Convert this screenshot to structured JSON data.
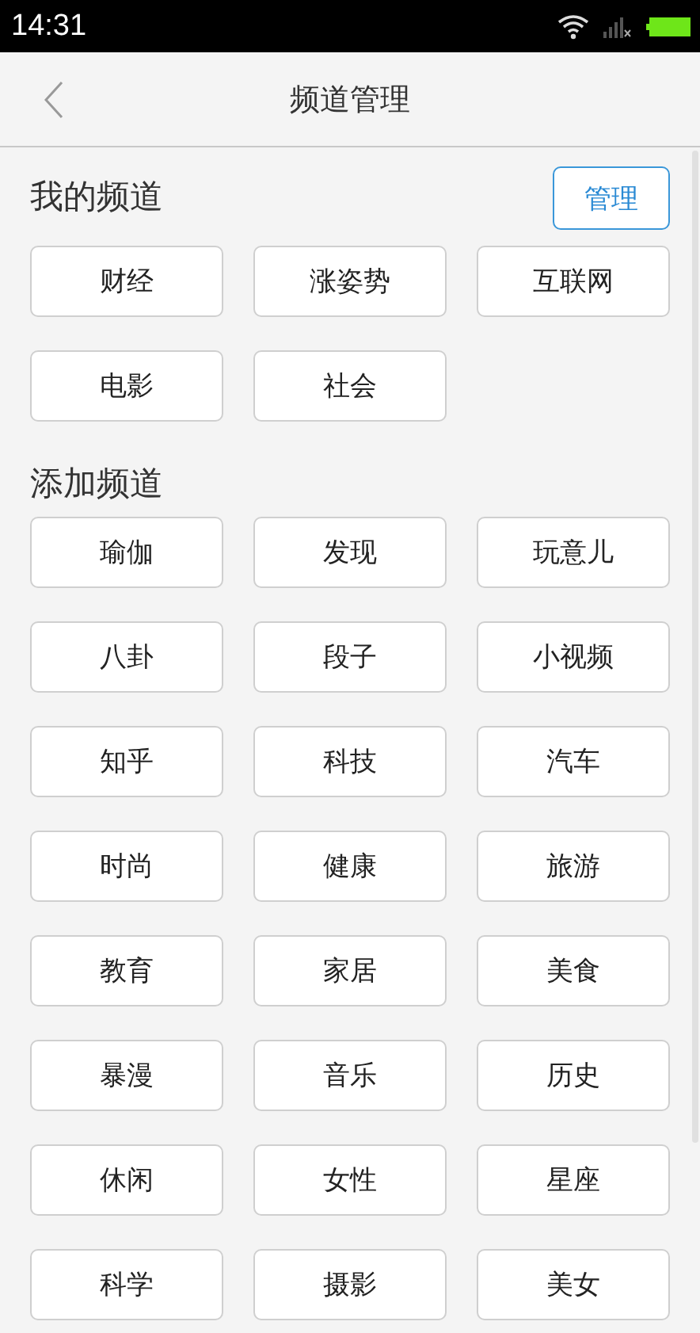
{
  "status_bar": {
    "time": "14:31"
  },
  "header": {
    "title": "频道管理"
  },
  "my_channels": {
    "title": "我的频道",
    "manage_button": "管理",
    "items": [
      "财经",
      "涨姿势",
      "互联网",
      "电影",
      "社会"
    ]
  },
  "add_channels": {
    "title": "添加频道",
    "items": [
      "瑜伽",
      "发现",
      "玩意儿",
      "八卦",
      "段子",
      "小视频",
      "知乎",
      "科技",
      "汽车",
      "时尚",
      "健康",
      "旅游",
      "教育",
      "家居",
      "美食",
      "暴漫",
      "音乐",
      "历史",
      "休闲",
      "女性",
      "星座",
      "科学",
      "摄影",
      "美女"
    ]
  }
}
